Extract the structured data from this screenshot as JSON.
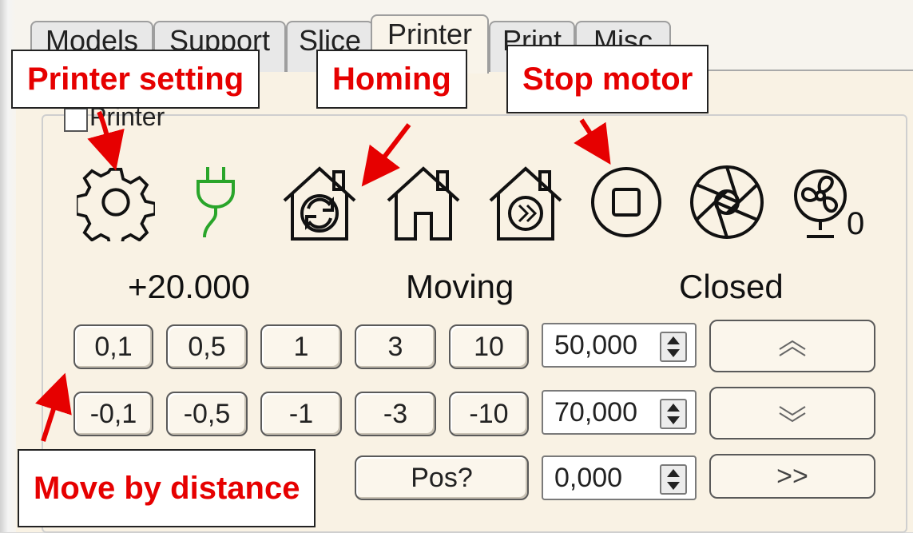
{
  "tabs": [
    "Models",
    "Support",
    "Slice",
    "Printer",
    "Print",
    "Misc"
  ],
  "active_tab": "Printer",
  "group": {
    "label": "Printer",
    "checked": false
  },
  "toolbar_icons": [
    "gear-icon",
    "plug-icon",
    "home-cycle-icon",
    "home-icon",
    "home-forward-icon",
    "stop-icon",
    "aperture-icon",
    "fan-icon"
  ],
  "fan_value": "0",
  "status": {
    "position": "+20.000",
    "state": "Moving",
    "door": "Closed"
  },
  "move_buttons_positive": [
    "0,1",
    "0,5",
    "1",
    "3",
    "10"
  ],
  "move_buttons_negative": [
    "-0,1",
    "-0,5",
    "-1",
    "-3",
    "-10"
  ],
  "spin_values": [
    "50,000",
    "70,000",
    "0,000"
  ],
  "pos_button": "Pos?",
  "forward_button": ">>",
  "callouts": {
    "printer_setting": "Printer setting",
    "homing": "Homing",
    "stop_motor": "Stop motor",
    "move_by_distance": "Move by distance"
  },
  "colors": {
    "annotation_red": "#e60000",
    "plug_green": "#2aa52a",
    "panel_bg": "#f9f2e4"
  }
}
